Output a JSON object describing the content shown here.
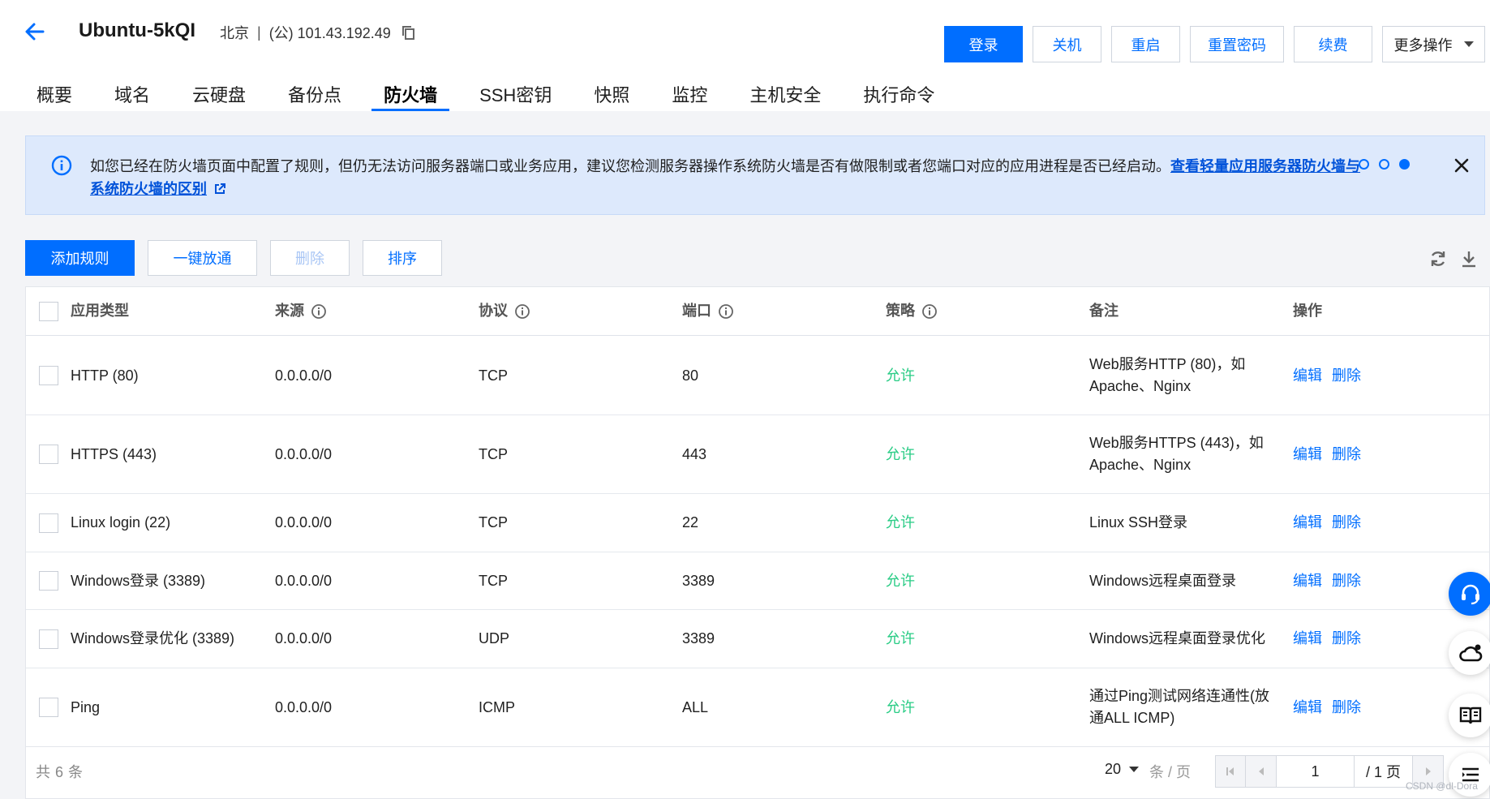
{
  "header": {
    "instance_name": "Ubuntu-5kQI",
    "region": "北京",
    "separator": "|",
    "ip": "(公) 101.43.192.49",
    "actions": [
      {
        "label": "登录",
        "primary": true
      },
      {
        "label": "关机"
      },
      {
        "label": "重启"
      },
      {
        "label": "重置密码"
      },
      {
        "label": "续费"
      }
    ],
    "more_label": "更多操作"
  },
  "tabs": [
    {
      "label": "概要"
    },
    {
      "label": "域名"
    },
    {
      "label": "云硬盘"
    },
    {
      "label": "备份点"
    },
    {
      "label": "防火墙",
      "active": true
    },
    {
      "label": "SSH密钥"
    },
    {
      "label": "快照"
    },
    {
      "label": "监控"
    },
    {
      "label": "主机安全"
    },
    {
      "label": "执行命令"
    }
  ],
  "notice": {
    "text": "如您已经在防火墙页面中配置了规则，但仍无法访问服务器端口或业务应用，建议您检测服务器操作系统防火墙是否有做限制或者您端口对应的应用进程是否已经启动。",
    "link_text": "查看轻量应用服务器防火墙与系统防火墙的区别",
    "dots": [
      false,
      false,
      true
    ]
  },
  "toolbar": {
    "add_rule": "添加规则",
    "one_click": "一键放通",
    "delete": "删除",
    "sort": "排序"
  },
  "table": {
    "headers": {
      "app": "应用类型",
      "source": "来源",
      "protocol": "协议",
      "port": "端口",
      "policy": "策略",
      "note": "备注",
      "ops": "操作"
    },
    "rows": [
      {
        "app": "HTTP (80)",
        "source": "0.0.0.0/0",
        "protocol": "TCP",
        "port": "80",
        "policy": "允许",
        "note": "Web服务HTTP (80)，如Apache、Nginx"
      },
      {
        "app": "HTTPS (443)",
        "source": "0.0.0.0/0",
        "protocol": "TCP",
        "port": "443",
        "policy": "允许",
        "note": "Web服务HTTPS (443)，如Apache、Nginx"
      },
      {
        "app": "Linux login (22)",
        "source": "0.0.0.0/0",
        "protocol": "TCP",
        "port": "22",
        "policy": "允许",
        "note": "Linux SSH登录"
      },
      {
        "app": "Windows登录 (3389)",
        "source": "0.0.0.0/0",
        "protocol": "TCP",
        "port": "3389",
        "policy": "允许",
        "note": "Windows远程桌面登录"
      },
      {
        "app": "Windows登录优化 (3389)",
        "source": "0.0.0.0/0",
        "protocol": "UDP",
        "port": "3389",
        "policy": "允许",
        "note": "Windows远程桌面登录优化"
      },
      {
        "app": "Ping",
        "source": "0.0.0.0/0",
        "protocol": "ICMP",
        "port": "ALL",
        "policy": "允许",
        "note": "通过Ping测试网络连通性(放通ALL ICMP)"
      }
    ],
    "edit_label": "编辑",
    "delete_label": "删除"
  },
  "footer": {
    "total_prefix": "共",
    "total_count": "6",
    "total_suffix": "条",
    "page_size": "20",
    "per_page_label": "条 / 页",
    "current_page": "1",
    "total_pages": "/ 1 页"
  },
  "watermark": "CSDN @dl-Dora",
  "colors": {
    "primary": "#006eff",
    "allow": "#29cc85",
    "notice_bg": "#dde9fc"
  },
  "icons": [
    "back-arrow-icon",
    "copy-icon",
    "info-icon",
    "external-link-icon",
    "close-icon",
    "refresh-icon",
    "download-icon",
    "headset-icon",
    "cloud-icon",
    "book-icon",
    "menu-icon"
  ]
}
